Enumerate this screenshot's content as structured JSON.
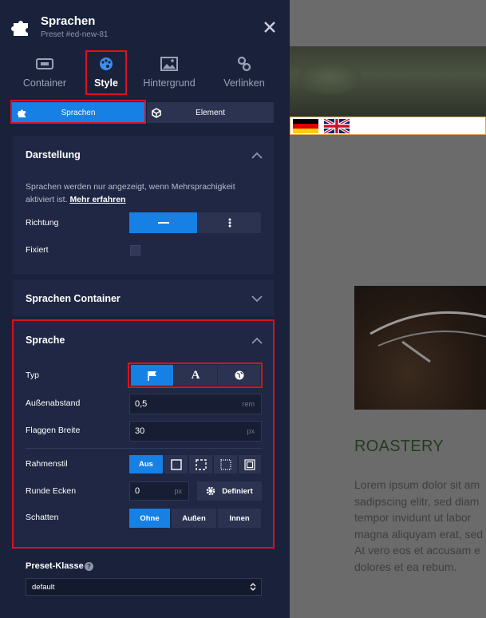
{
  "header": {
    "title": "Sprachen",
    "subtitle": "Preset #ed-new-81"
  },
  "tabs": [
    {
      "label": "Container",
      "icon": "container-icon"
    },
    {
      "label": "Style",
      "icon": "palette-icon"
    },
    {
      "label": "Hintergrund",
      "icon": "image-icon"
    },
    {
      "label": "Verlinken",
      "icon": "link-icon"
    }
  ],
  "subtabs": {
    "sprachen": "Sprachen",
    "element": "Element"
  },
  "darstellung": {
    "title": "Darstellung",
    "description": "Sprachen werden nur angezeigt, wenn Mehrsprachigkeit aktiviert ist.",
    "link": "Mehr erfahren",
    "richtung_label": "Richtung",
    "fixiert_label": "Fixiert"
  },
  "sprachen_container": {
    "title": "Sprachen Container"
  },
  "sprache": {
    "title": "Sprache",
    "typ_label": "Typ",
    "aussenabstand_label": "Außenabstand",
    "aussenabstand_value": "0,5",
    "aussenabstand_unit": "rem",
    "flaggen_label": "Flaggen Breite",
    "flaggen_value": "30",
    "flaggen_unit": "px",
    "rahmenstil_label": "Rahmenstil",
    "rahmenstil_aus": "Aus",
    "runde_label": "Runde Ecken",
    "runde_value": "0",
    "runde_unit": "px",
    "definiert": "Definiert",
    "schatten_label": "Schatten",
    "schatten": [
      "Ohne",
      "Außen",
      "Innen"
    ]
  },
  "preset": {
    "label": "Preset-Klasse",
    "value": "default"
  },
  "canvas": {
    "heading": "ROASTERY",
    "lorem_lines": [
      "Lorem ipsum dolor sit am",
      "sadipscing elitr, sed diam",
      "tempor invidunt ut labor",
      "magna aliquyam erat, sed",
      "At vero eos et accusam e",
      "dolores et ea rebum."
    ],
    "accent_heading": "#243b20"
  },
  "colors": {
    "panel": "#1a213a",
    "active": "#1680e5",
    "highlight": "#e00f1e"
  }
}
